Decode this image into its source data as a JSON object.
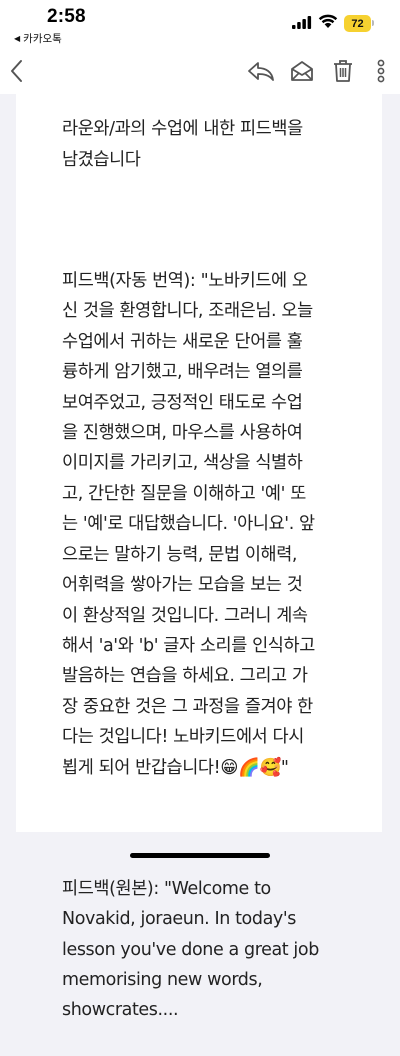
{
  "status_bar": {
    "time": "2:58",
    "back_app_label": "카카오톡",
    "battery_level": "72"
  },
  "toolbar": {
    "icons": [
      "back-chevron-icon",
      "reply-icon",
      "envelope-icon",
      "trash-icon",
      "more-vertical-icon"
    ]
  },
  "email": {
    "paragraph_top": "라운와/과의 수업에 내한 피드백을\n남겼습니다",
    "feedback_translated": "피드백(자동 번역): \"노바키드에 오\n신 것을 환영합니다, 조래은님. 오늘\n수업에서 귀하는 새로운 단어를 훌\n륭하게 암기했고, 배우려는 열의를\n보여주었고, 긍정적인 태도로 수업\n을 진행했으며, 마우스를 사용하여\n이미지를 가리키고, 색상을 식별하\n고, 간단한 질문을 이해하고 '예' 또\n는 '예'로 대답했습니다. '아니요'. 앞\n으로는 말하기 능력, 문법 이해력,\n어휘력을 쌓아가는 모습을 보는 것\n이 환상적일 것입니다. 그러니 계속\n해서 'a'와 'b' 글자 소리를 인식하고\n발음하는 연습을 하세요. 그리고 가\n장 중요한 것은 그 과정을 즐겨야 한\n다는 것입니다! 노바키드에서 다시\n뵙게 되어 반갑습니다!😁🌈🥰\"",
    "feedback_original": "피드백(원본): \"Welcome to\nNovakid, joraeun. In today's\nlesson you've done a great job\nmemorising new words,\nshowcrates...."
  },
  "colors": {
    "background": "#f2f2f7",
    "card": "#ffffff",
    "text": "#222222",
    "battery": "#f6d130",
    "icon": "#555555"
  }
}
